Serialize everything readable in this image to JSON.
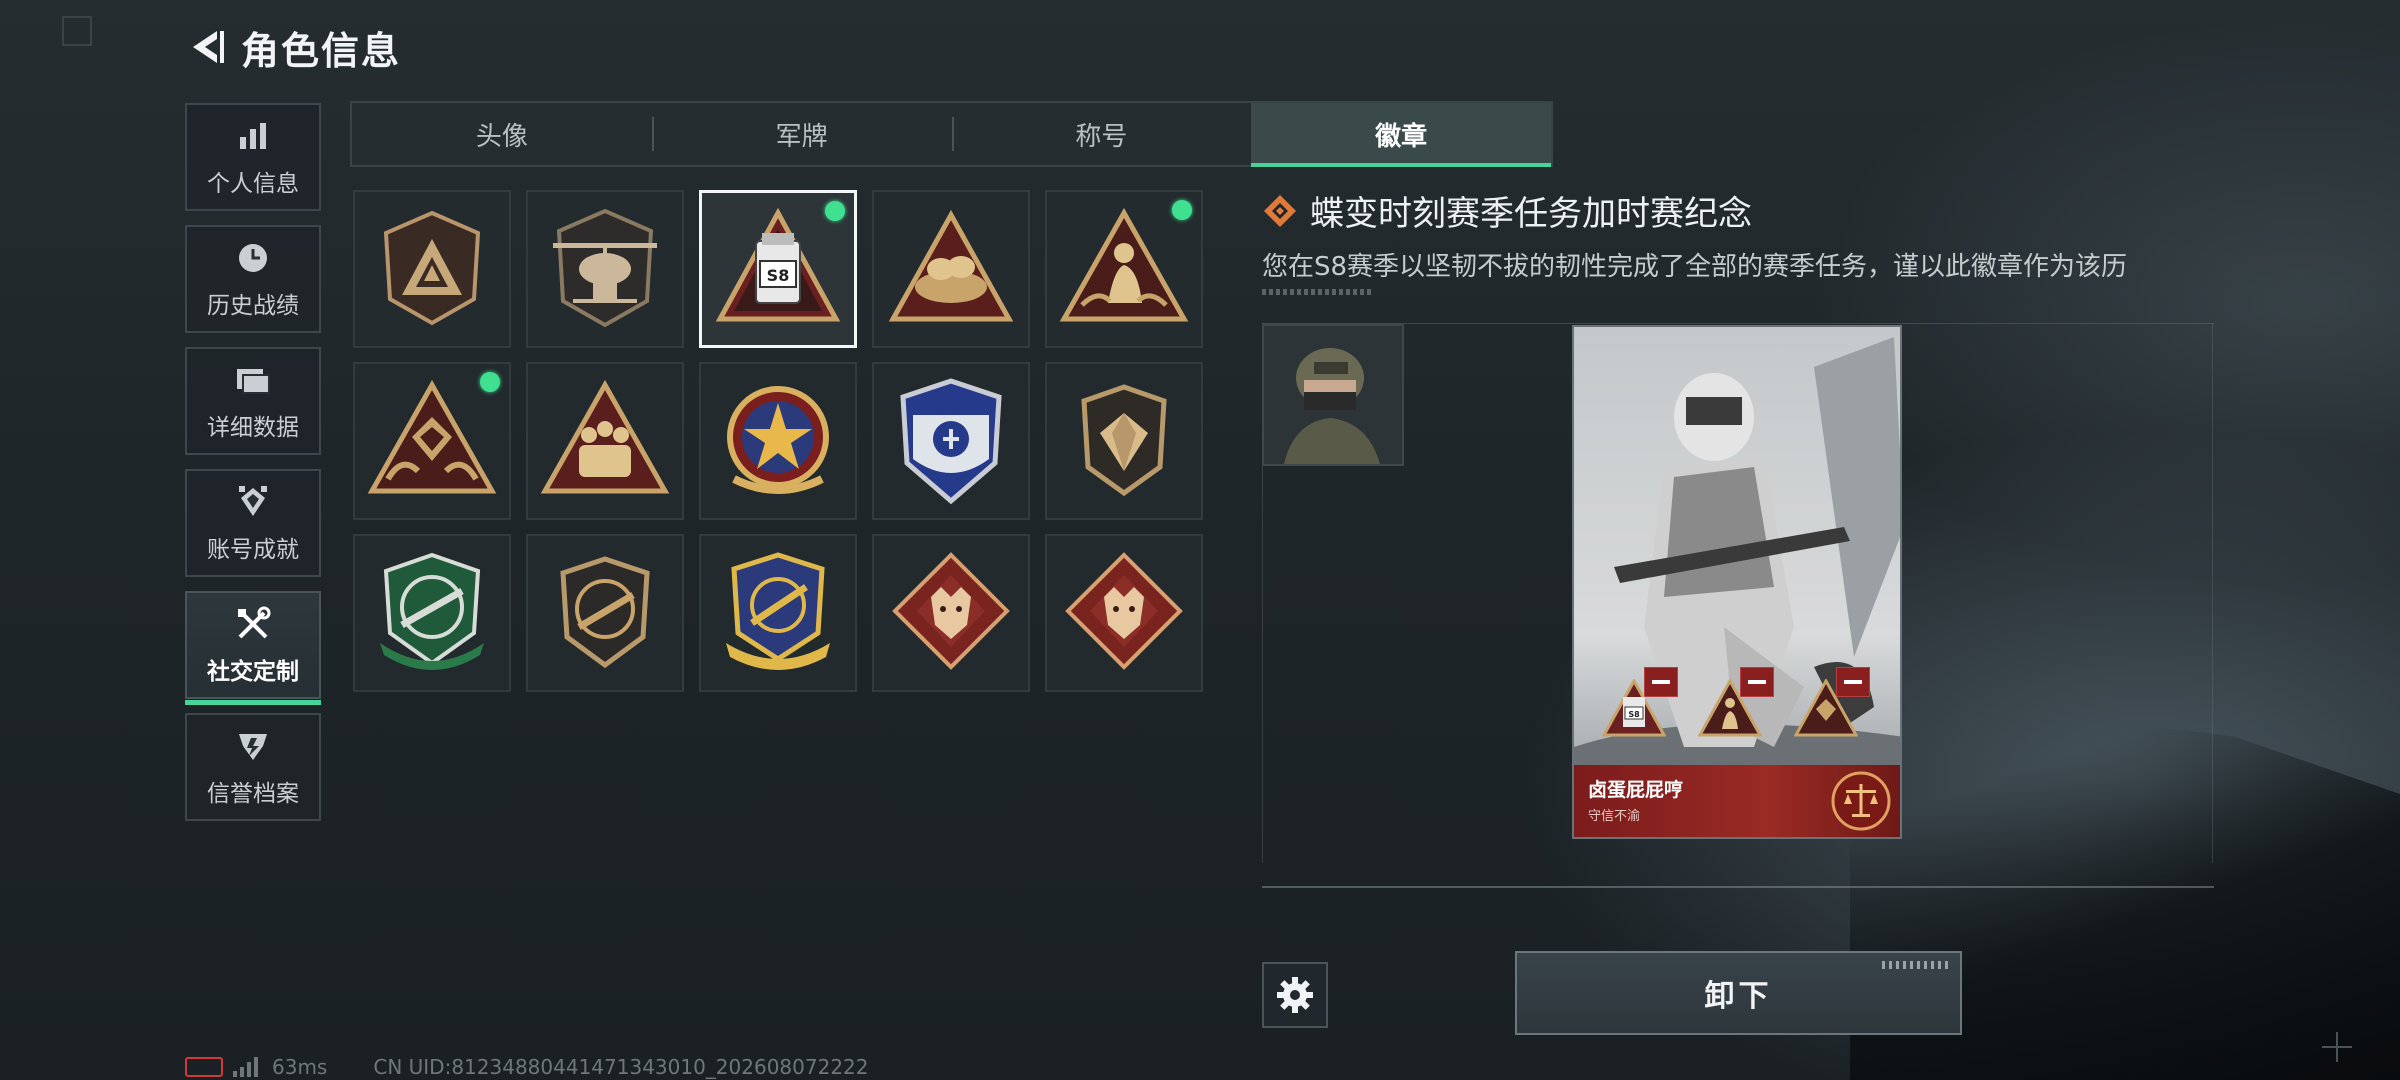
{
  "header": {
    "title": "角色信息"
  },
  "sidebar": {
    "items": [
      {
        "label": "个人信息",
        "icon": "bar-chart-icon"
      },
      {
        "label": "历史战绩",
        "icon": "clock-icon"
      },
      {
        "label": "详细数据",
        "icon": "folder-icon"
      },
      {
        "label": "账号成就",
        "icon": "achievement-icon"
      },
      {
        "label": "社交定制",
        "icon": "tools-icon",
        "active": true
      },
      {
        "label": "信誉档案",
        "icon": "reputation-icon"
      }
    ]
  },
  "tabs": [
    {
      "label": "头像"
    },
    {
      "label": "军牌"
    },
    {
      "label": "称号"
    },
    {
      "label": "徽章",
      "active": true
    }
  ],
  "badges": {
    "selected_index": 2,
    "new_indicator_indices": [
      2,
      4,
      5
    ],
    "items": [
      {
        "icon": "triangle-shield-badge-icon"
      },
      {
        "icon": "helicopter-badge-icon"
      },
      {
        "icon": "s8-robot-badge-icon",
        "text": "S8"
      },
      {
        "icon": "nest-triangle-badge-icon"
      },
      {
        "icon": "figure-triangle-badge-icon"
      },
      {
        "icon": "hands-diamond-badge-icon"
      },
      {
        "icon": "squad-triangle-badge-icon"
      },
      {
        "icon": "star-ribbon-badge-icon"
      },
      {
        "icon": "blue-shield-badge-icon"
      },
      {
        "icon": "gem-shield-badge-icon"
      },
      {
        "icon": "green-rifle-badge-icon"
      },
      {
        "icon": "dark-rifle-badge-icon"
      },
      {
        "icon": "blue-gold-rifle-badge-icon"
      },
      {
        "icon": "wolf-diamond-badge-icon"
      },
      {
        "icon": "wolf-diamond-badge-icon-2"
      }
    ]
  },
  "detail": {
    "title": "蝶变时刻赛季任务加时赛纪念",
    "description": "您在S8赛季以坚韧不拔的韧性完成了全部的赛季任务，谨以此徽章作为该历",
    "card": {
      "player_name": "卤蛋屁屁哼",
      "subtitle": "守信不渝"
    },
    "unequip_label": "卸下"
  },
  "status": {
    "ping": "63ms",
    "uid": "CN UID:81234880441471343010_202608072222"
  },
  "colors": {
    "accent": "#46d49a",
    "new_dot": "#3fe08f",
    "card_footer": "#9a2a24",
    "title_icon": "#e07a3a"
  }
}
